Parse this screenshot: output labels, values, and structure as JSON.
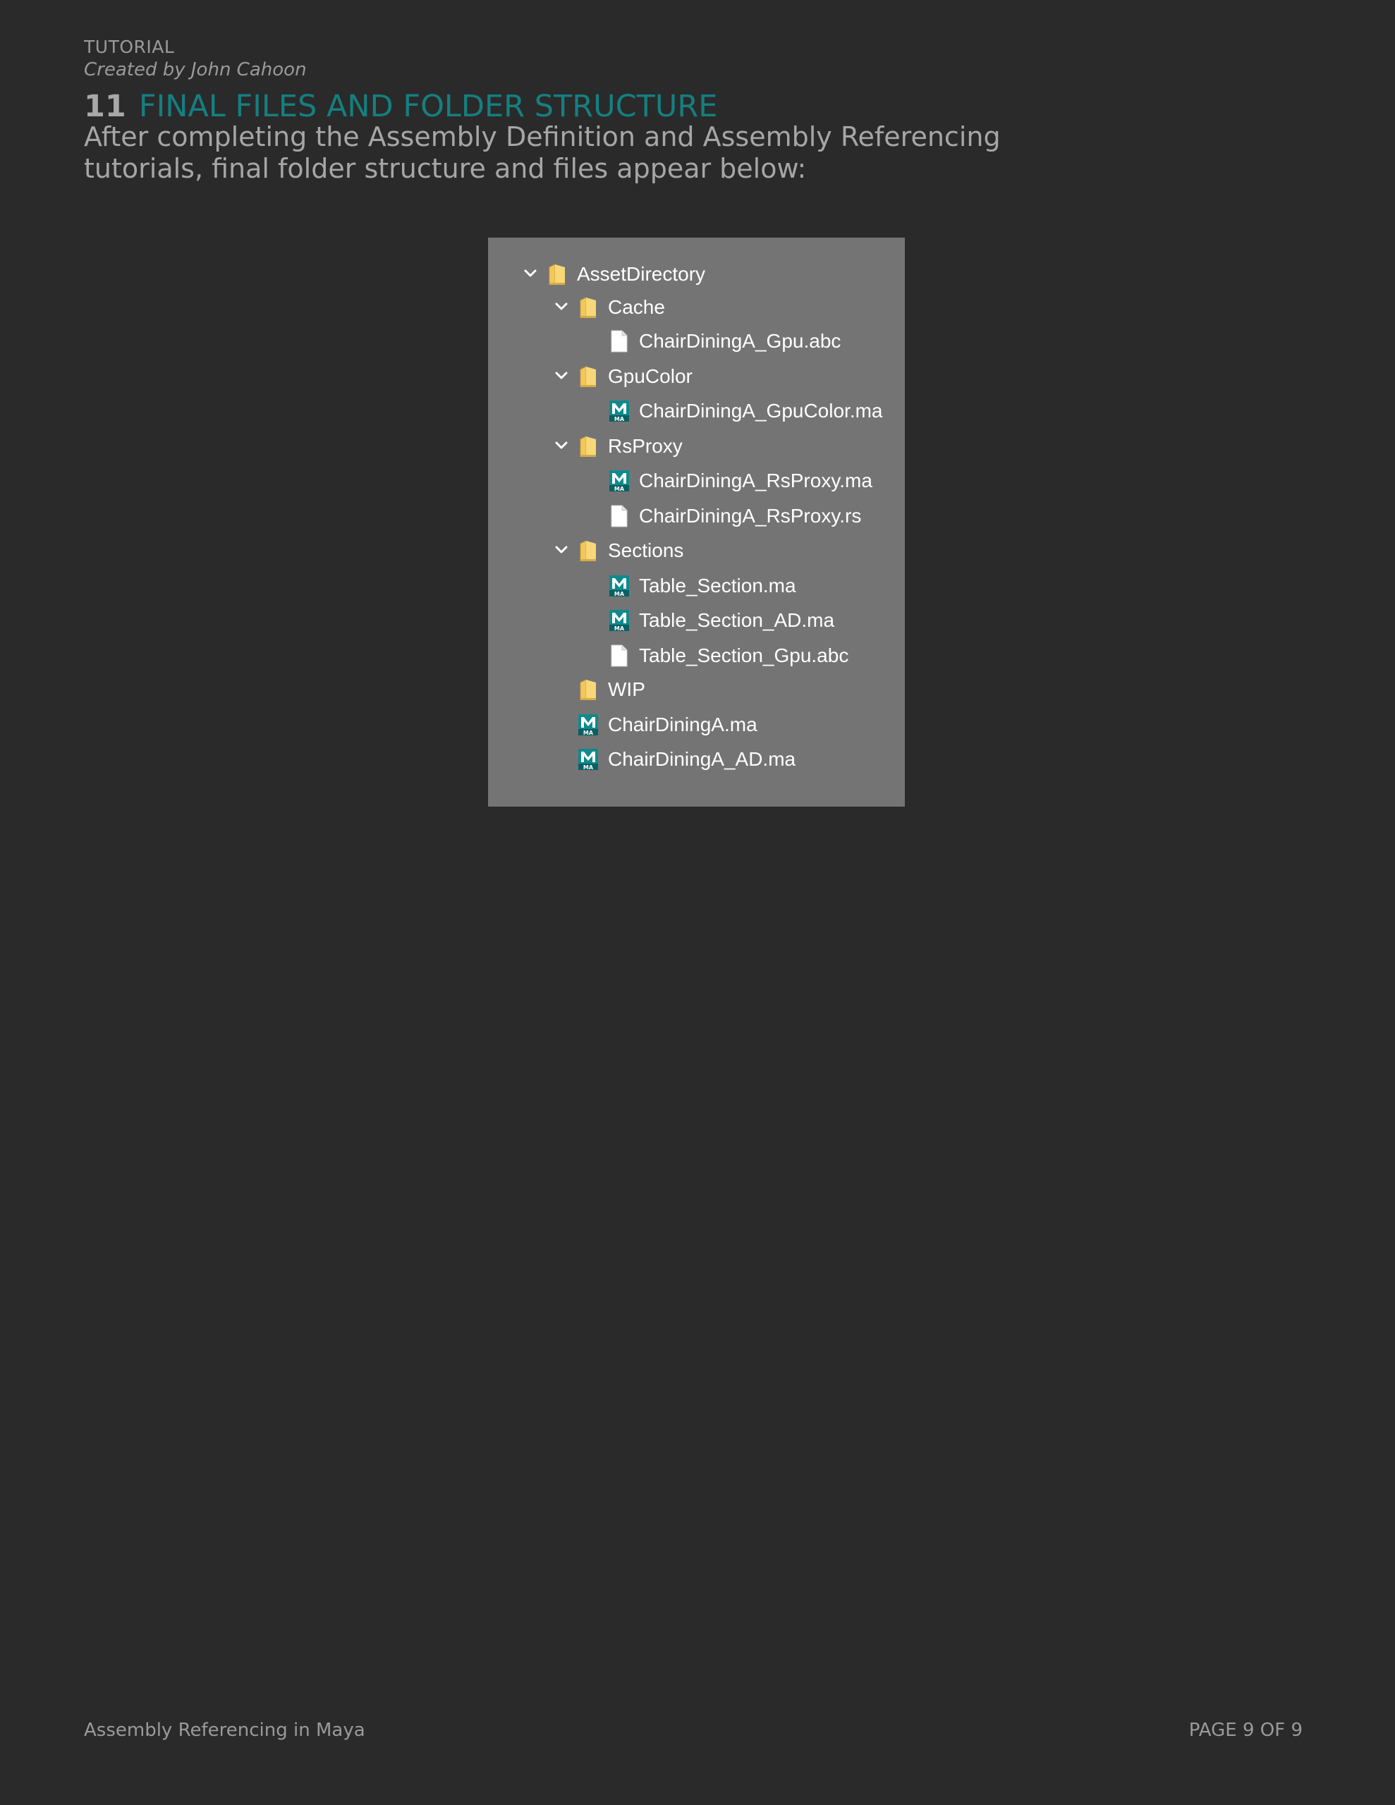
{
  "header": {
    "label": "TUTORIAL",
    "author": "Created by John Cahoon"
  },
  "section": {
    "number": "11",
    "title": "FINAL FILES AND FOLDER STRUCTURE",
    "intro": "After completing the Assembly Definition and Assembly Referencing tutorials, final folder structure and files appear below:"
  },
  "tree": [
    {
      "label": "AssetDirectory",
      "kind": "folder",
      "depth": 0,
      "expanded": true,
      "icon": "folder-icon"
    },
    {
      "label": "Cache",
      "kind": "folder",
      "depth": 1,
      "expanded": true,
      "icon": "folder-icon"
    },
    {
      "label": "ChairDiningA_Gpu.abc",
      "kind": "file",
      "depth": 2,
      "icon": "file-icon"
    },
    {
      "label": "GpuColor",
      "kind": "folder",
      "depth": 1,
      "expanded": true,
      "icon": "folder-icon"
    },
    {
      "label": "ChairDiningA_GpuColor.ma",
      "kind": "maya",
      "depth": 2,
      "icon": "maya-file-icon"
    },
    {
      "label": "RsProxy",
      "kind": "folder",
      "depth": 1,
      "expanded": true,
      "icon": "folder-icon"
    },
    {
      "label": "ChairDiningA_RsProxy.ma",
      "kind": "maya",
      "depth": 2,
      "icon": "maya-file-icon"
    },
    {
      "label": "ChairDiningA_RsProxy.rs",
      "kind": "file",
      "depth": 2,
      "icon": "file-icon"
    },
    {
      "label": "Sections",
      "kind": "folder",
      "depth": 1,
      "expanded": true,
      "icon": "folder-icon"
    },
    {
      "label": "Table_Section.ma",
      "kind": "maya",
      "depth": 2,
      "icon": "maya-file-icon"
    },
    {
      "label": "Table_Section_AD.ma",
      "kind": "maya",
      "depth": 2,
      "icon": "maya-file-icon"
    },
    {
      "label": "Table_Section_Gpu.abc",
      "kind": "file",
      "depth": 2,
      "icon": "file-icon"
    },
    {
      "label": "WIP",
      "kind": "folder",
      "depth": 1,
      "expanded": false,
      "icon": "folder-icon"
    },
    {
      "label": "ChairDiningA.ma",
      "kind": "maya",
      "depth": 1,
      "icon": "maya-file-icon"
    },
    {
      "label": "ChairDiningA_AD.ma",
      "kind": "maya",
      "depth": 1,
      "icon": "maya-file-icon"
    }
  ],
  "maya_badge": "MA",
  "colors": {
    "background": "#2a2a2a",
    "panel": "#747474",
    "accent": "#157f80",
    "muted_text": "#9a9a9a",
    "folder": "#f3c75a",
    "maya_teal": "#0e8a8c"
  },
  "footer": {
    "doc_title": "Assembly Referencing in Maya",
    "page": "PAGE 9 OF 9"
  }
}
